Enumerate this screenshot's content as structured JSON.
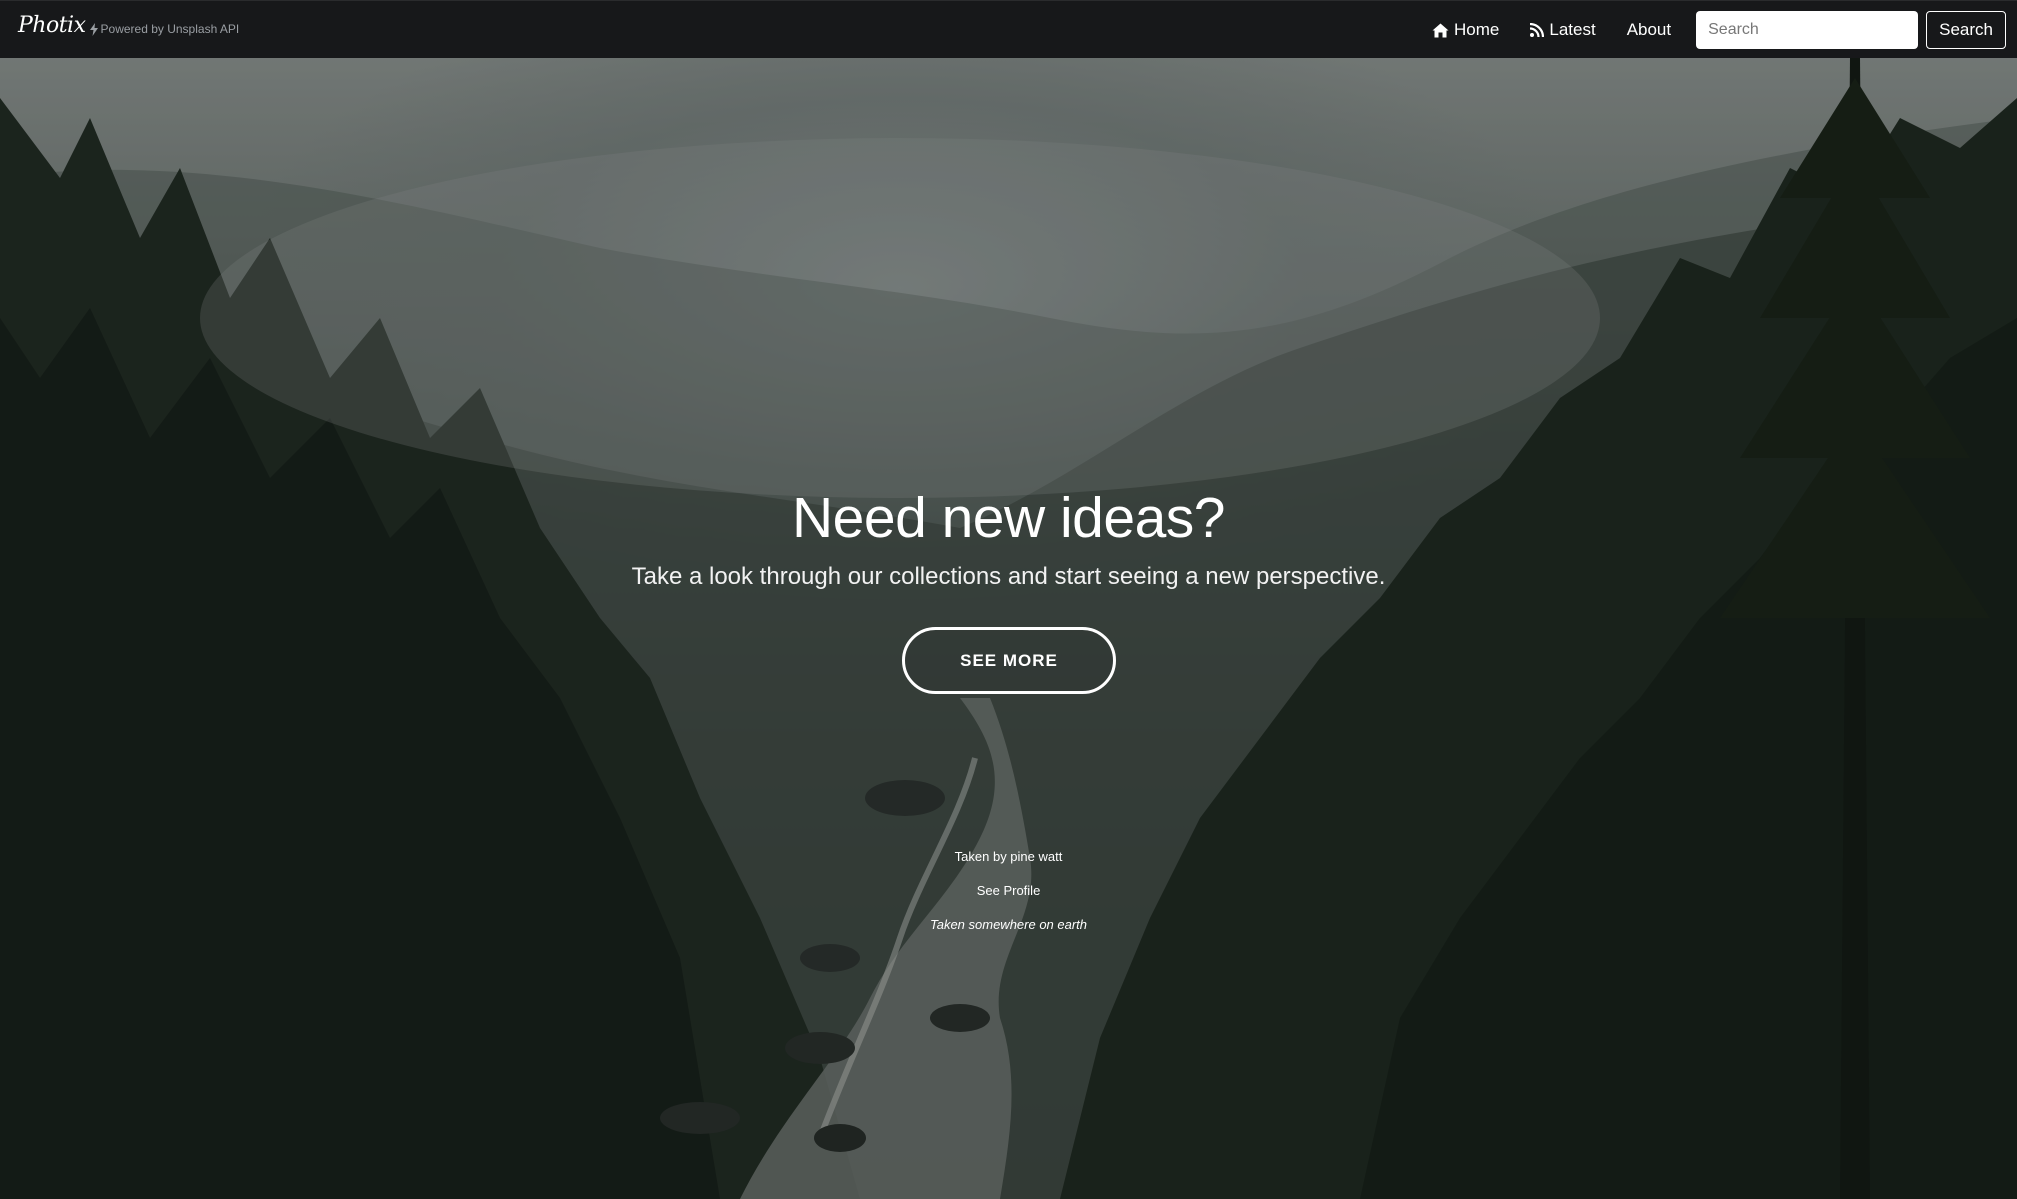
{
  "navbar": {
    "brand": "Photix",
    "powered_by": "Powered by Unsplash API",
    "links": [
      {
        "label": "Home",
        "icon": "home-icon"
      },
      {
        "label": "Latest",
        "icon": "rss-icon"
      },
      {
        "label": "About"
      }
    ],
    "search_placeholder": "Search",
    "search_button": "Search"
  },
  "hero": {
    "title": "Need new ideas?",
    "subtitle": "Take a look through our collections and start seeing a new perspective.",
    "cta_label": "SEE MORE",
    "photo_credit": "Taken by pine watt",
    "profile_link": "See Profile",
    "location": "Taken somewhere on earth"
  },
  "colors": {
    "navbar_bg": "#17181a",
    "text": "#ffffff",
    "muted": "#9a9ea3"
  }
}
